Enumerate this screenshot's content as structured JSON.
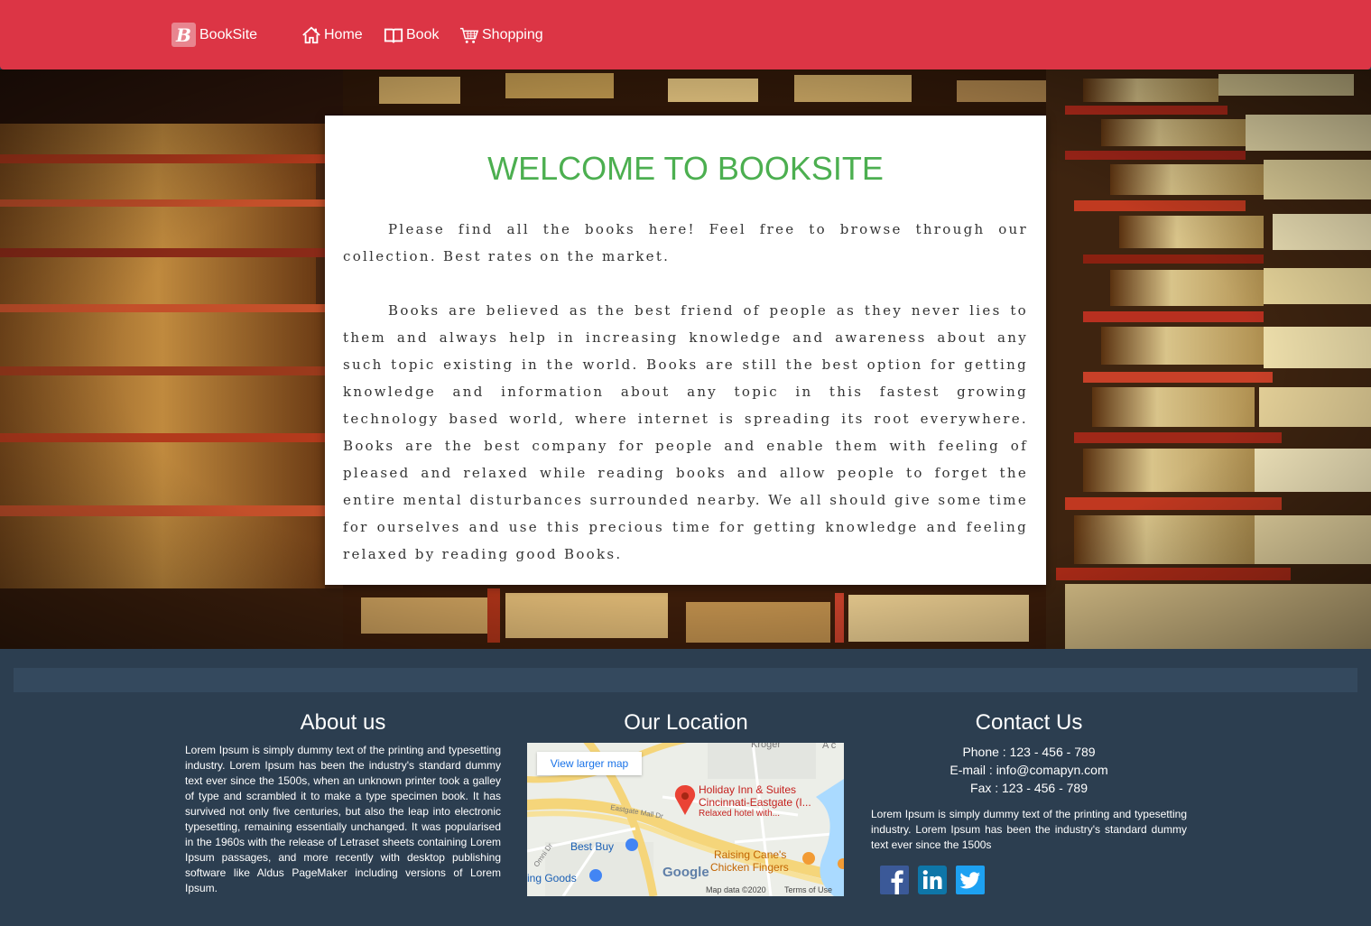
{
  "nav": {
    "brand_letter": "B",
    "brand": "BookSite",
    "links": [
      {
        "label": "Home",
        "icon": "home-icon"
      },
      {
        "label": "Book",
        "icon": "open-book-icon"
      },
      {
        "label": "Shopping",
        "icon": "shopping-cart-icon"
      }
    ]
  },
  "hero": {
    "title": "WELCOME TO BOOKSITE",
    "paragraphs": [
      "Please find all the books here! Feel free to browse through our collection. Best rates on the market.",
      "Books are believed as the best friend of people as they never lies to them and always help in increasing knowledge and awareness about any such topic existing in the world. Books are still the best option for getting knowledge and information about any topic in this fastest growing technology based world, where internet is spreading its root everywhere. Books are the best company for people and enable them with feeling of pleased and relaxed while reading books and allow people to forget the entire mental disturbances surrounded nearby. We all should give some time for ourselves and use this precious time for getting knowledge and feeling relaxed by reading good Books."
    ]
  },
  "footer": {
    "about": {
      "title": "About us",
      "text": "Lorem Ipsum is simply dummy text of the printing and typesetting industry. Lorem Ipsum has been the industry's standard dummy text ever since the 1500s, when an unknown printer took a galley of type and scrambled it to make a type specimen book. It has survived not only five centuries, but also the leap into electronic typesetting, remaining essentially unchanged. It was popularised in the 1960s with the release of Letraset sheets containing Lorem Ipsum passages, and more recently with desktop publishing software like Aldus PageMaker including versions of Lorem Ipsum."
    },
    "location": {
      "title": "Our Location",
      "map_button": "View larger map",
      "labels": {
        "kroger": "Kroger",
        "ac": "A c",
        "hotel_name": "Holiday Inn & Suites",
        "hotel_name2": "Cincinnati-Eastgate (I...",
        "hotel_desc": "Relaxed hotel with...",
        "eastgate": "Eastgate Mall Dr",
        "best_buy": "Best Buy",
        "omni": "Omni Dr",
        "raising": "Raising Cane's",
        "raising2": "Chicken Fingers",
        "goods": "ing Goods",
        "google": "Google",
        "map_data": "Map data ©2020",
        "terms": "Terms of Use"
      }
    },
    "contact": {
      "title": "Contact Us",
      "phone": "Phone : 123 - 456 - 789",
      "email": "E-mail : info@comapyn.com",
      "fax": "Fax : 123 - 456 - 789",
      "text": "Lorem Ipsum is simply dummy text of the printing and typesetting industry. Lorem Ipsum has been the industry's standard dummy text ever since the 1500s",
      "social": [
        "facebook-icon",
        "linkedin-icon",
        "twitter-icon"
      ]
    }
  },
  "colors": {
    "navbar": "#dc3545",
    "title_green": "#4caf50",
    "footer": "#2c3e50",
    "facebook": "#3b5998",
    "linkedin": "#0e76a8",
    "twitter": "#1da1f2"
  }
}
